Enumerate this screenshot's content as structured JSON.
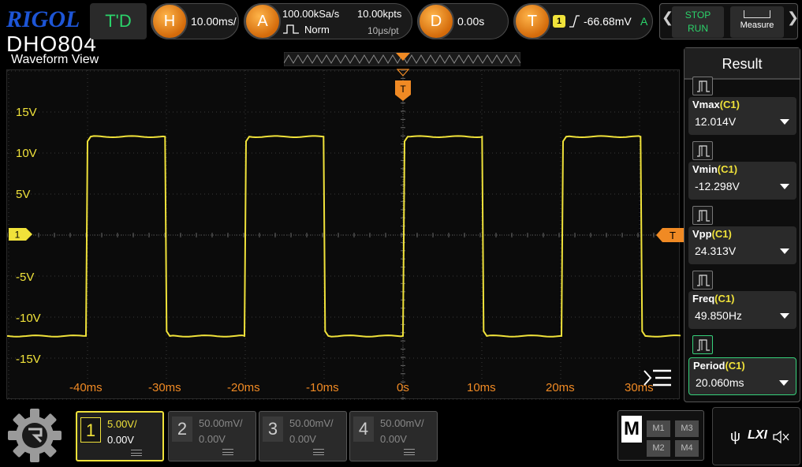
{
  "brand": {
    "logo": "RIGOL",
    "model": "DHO804"
  },
  "topbar": {
    "td_label": "T'D",
    "horizontal": {
      "icon": "H",
      "scale": "10.00ms/"
    },
    "acquire": {
      "icon": "A",
      "sample_rate": "100.00kSa/s",
      "memory_depth": "10.00kpts",
      "mode": "Norm",
      "time_per_point": "10μs/pt"
    },
    "delay": {
      "icon": "D",
      "value": "0.00s"
    },
    "trigger": {
      "icon": "T",
      "source": "1",
      "level": "-66.68mV",
      "coupling": "A"
    },
    "stop_label": "STOP",
    "run_label": "RUN",
    "measure_label": "Measure"
  },
  "waveform": {
    "title": "Waveform View",
    "y_labels": [
      "15V",
      "10V",
      "5V",
      "-5V",
      "-10V",
      "-15V"
    ],
    "x_labels": [
      "-40ms",
      "-30ms",
      "-20ms",
      "-10ms",
      "0s",
      "10ms",
      "20ms",
      "30ms"
    ],
    "channel_marker": "1",
    "trigger_marker": "T",
    "trace_color": "#f0e23a",
    "trigger_color": "#f08a24",
    "signal": {
      "high_v": 12.0,
      "low_v": -12.3,
      "period_ms": 20.06,
      "rising_edges_ms": [
        -40.2,
        -20.1,
        0.0,
        20.1
      ]
    }
  },
  "result_panel": {
    "title": "Result",
    "items": [
      {
        "name": "Vmax",
        "channel": "(C1)",
        "value": "12.014V"
      },
      {
        "name": "Vmin",
        "channel": "(C1)",
        "value": "-12.298V"
      },
      {
        "name": "Vpp",
        "channel": "(C1)",
        "value": "24.313V"
      },
      {
        "name": "Freq",
        "channel": "(C1)",
        "value": "49.850Hz"
      },
      {
        "name": "Period",
        "channel": "(C1)",
        "value": "20.060ms"
      }
    ]
  },
  "channels": [
    {
      "num": "1",
      "scale": "5.00V/",
      "offset": "0.00V"
    },
    {
      "num": "2",
      "scale": "50.00mV/",
      "offset": "0.00V"
    },
    {
      "num": "3",
      "scale": "50.00mV/",
      "offset": "0.00V"
    },
    {
      "num": "4",
      "scale": "50.00mV/",
      "offset": "0.00V"
    }
  ],
  "math": {
    "label": "M",
    "buttons": [
      "M1",
      "M3",
      "M2",
      "M4"
    ]
  },
  "status": {
    "lxi_label": "LXI"
  }
}
